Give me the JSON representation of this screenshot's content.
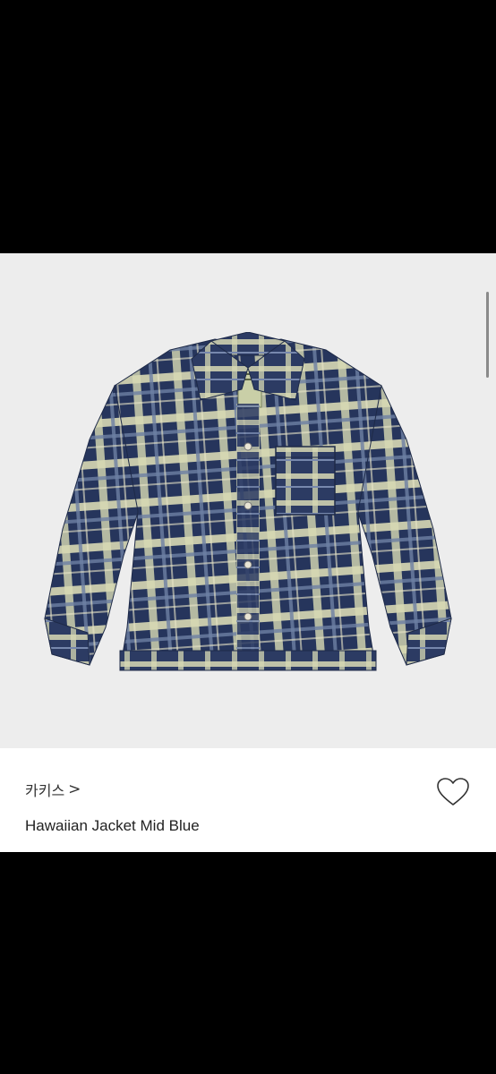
{
  "product": {
    "brand": "카키스",
    "brand_chevron": ">",
    "title": "Hawaiian Jacket Mid Blue"
  },
  "icons": {
    "wishlist": "heart-outline-icon",
    "brand_chevron": "chevron-right-icon"
  },
  "colors": {
    "background": "#000000",
    "image_background": "#ededed",
    "panel": "#ffffff",
    "plaid_navy": "#26355c",
    "plaid_cream": "#d7d9b4"
  }
}
